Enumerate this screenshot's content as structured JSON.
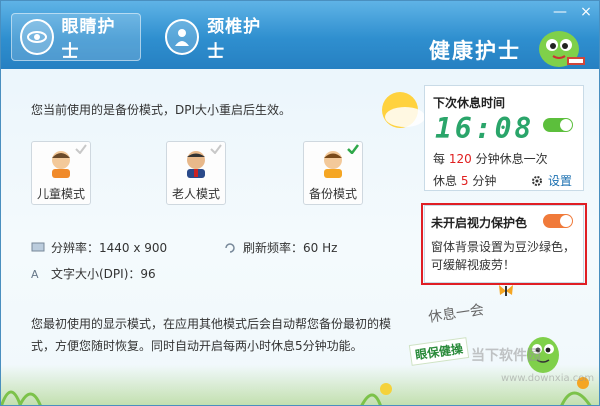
{
  "header": {
    "tabs": [
      {
        "label": "眼睛护士",
        "active": true
      },
      {
        "label": "颈椎护士",
        "active": false
      }
    ],
    "brand": "健康护士",
    "min_label": "—",
    "close_label": "×"
  },
  "main": {
    "info": "您当前使用的是备份模式，DPI大小重启后生效。",
    "modes": [
      {
        "label": "儿童模式",
        "checked": false
      },
      {
        "label": "老人模式",
        "checked": false
      },
      {
        "label": "备份模式",
        "checked": true
      }
    ],
    "stats": {
      "resolution": "分辨率：1440 x 900",
      "refresh": "刷新频率：60 Hz",
      "dpi": "文字大小(DPI)：96"
    },
    "description": "您最初使用的显示模式，在应用其他模式后会自动帮您备份最初的模式，方便您随时恢复。同时自动开启每两小时休息5分钟功能。"
  },
  "rest_panel": {
    "title": "下次休息时间",
    "time": "16:08",
    "toggle_on": true,
    "every_label": "每",
    "every_value": "120",
    "every_suffix": "分钟休息一次",
    "rest_label": "休息",
    "rest_value": "5",
    "rest_suffix": "分钟",
    "settings_label": "设置"
  },
  "protect_panel": {
    "title": "未开启视力保护色",
    "toggle_on": true,
    "text": "窗体背景设置为豆沙绿色，可缓解视疲劳！"
  },
  "decor": {
    "rest_text": "休息一会",
    "eye_health": "眼保健操",
    "watermark": "当下软件园",
    "watermark_url": "www.downxia.com"
  },
  "colors": {
    "header": "#2f8fcf",
    "toggle_on": "#f07a3a",
    "toggle_green": "#5cbf3c",
    "highlight_frame": "#e01e24",
    "digit_green": "#2aa56a"
  }
}
